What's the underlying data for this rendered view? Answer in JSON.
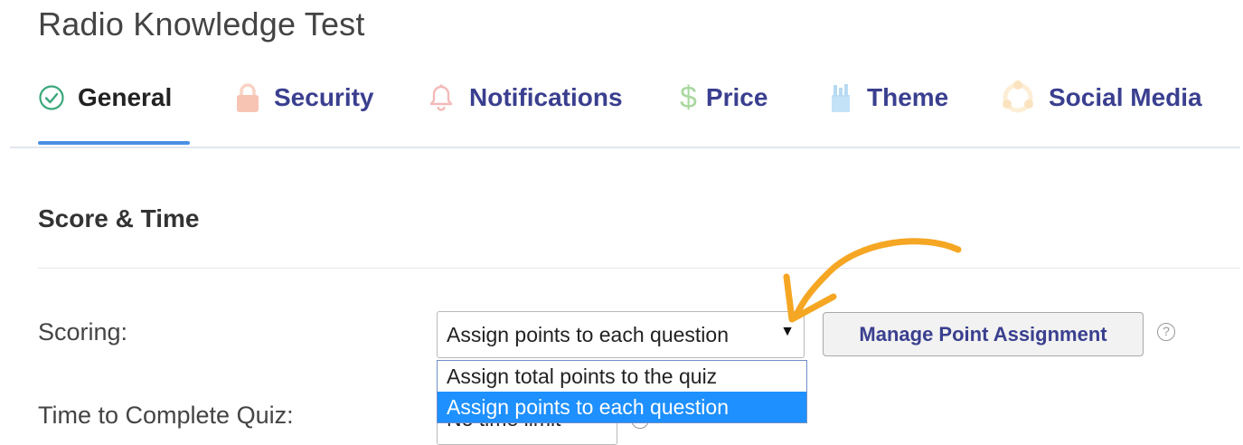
{
  "page": {
    "title": "Radio Knowledge Test"
  },
  "tabs": [
    {
      "label": "General",
      "icon": "check-circle-icon",
      "color": "#3aa77a",
      "active": true
    },
    {
      "label": "Security",
      "icon": "lock-icon",
      "color": "#f6b8a8",
      "active": false
    },
    {
      "label": "Notifications",
      "icon": "bell-icon",
      "color": "#f4b9b9",
      "active": false
    },
    {
      "label": "Price",
      "icon": "dollar-icon",
      "color": "#a9d8a0",
      "active": false
    },
    {
      "label": "Theme",
      "icon": "paint-brush-icon",
      "color": "#b7daf3",
      "active": false
    },
    {
      "label": "Social Media",
      "icon": "share-icon",
      "color": "#fbe3bf",
      "active": false
    }
  ],
  "section": {
    "title": "Score & Time"
  },
  "scoring": {
    "label": "Scoring:",
    "selected": "Assign points to each question",
    "options": [
      "Assign total points to the quiz",
      "Assign points to each question"
    ],
    "manage_button": "Manage Point Assignment",
    "help": "?"
  },
  "time": {
    "label": "Time to Complete Quiz:",
    "value": "No time limit",
    "help": "?"
  },
  "colors": {
    "accent": "#4a90e2",
    "tab_text": "#3a3f8f",
    "highlight": "#1e90ff",
    "annotation_arrow": "#f5a623"
  }
}
